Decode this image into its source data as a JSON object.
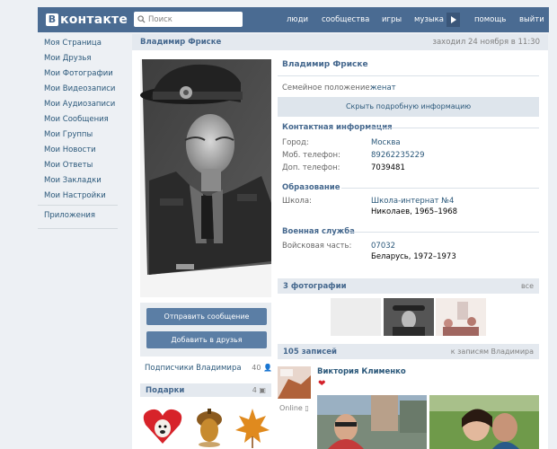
{
  "header": {
    "logo_text": "контакте",
    "logo_letter": "В",
    "search_placeholder": "Поиск",
    "nav": [
      "люди",
      "сообщества",
      "игры",
      "музыка",
      "помощь",
      "выйти"
    ]
  },
  "sidebar": {
    "items": [
      "Моя Страница",
      "Мои Друзья",
      "Мои Фотографии",
      "Мои Видеозаписи",
      "Мои Аудиозаписи",
      "Мои Сообщения",
      "Мои Группы",
      "Мои Новости",
      "Мои Ответы",
      "Мои Закладки",
      "Мои Настройки"
    ],
    "apps": "Приложения"
  },
  "profile": {
    "head_name": "Владимир Фриске",
    "last_seen": "заходил 24 ноября в 11:30",
    "name": "Владимир Фриске",
    "marital_label": "Семейное положение:",
    "marital_value": "женат",
    "hide_info": "Скрыть подробную информацию",
    "contact_title": "Контактная информация",
    "city_label": "Город:",
    "city_value": "Москва",
    "mobile_label": "Моб. телефон:",
    "mobile_value": "89262235229",
    "extra_phone_label": "Доп. телефон:",
    "extra_phone_value": "7039481",
    "education_title": "Образование",
    "school_label": "Школа:",
    "school_value": "Школа-интернат №4",
    "school_detail": "Николаев, 1965–1968",
    "military_title": "Военная служба",
    "unit_label": "Войсковая часть:",
    "unit_value": "07032",
    "unit_detail": "Беларусь, 1972–1973"
  },
  "actions": {
    "send_message": "Отправить сообщение",
    "add_friend": "Добавить в друзья"
  },
  "subscribers": {
    "label": "Подписчики Владимира",
    "count": "40"
  },
  "gifts": {
    "title": "Подарки",
    "count": "4"
  },
  "photos": {
    "title": "3 фотографии",
    "all": "все"
  },
  "wall": {
    "title": "105 записей",
    "link": "к записям Владимира",
    "post_author": "Виктория Клименко",
    "online": "Online"
  },
  "colors": {
    "brand": "#4a6b92",
    "link": "#2b587a",
    "button": "#5b7ea5"
  }
}
